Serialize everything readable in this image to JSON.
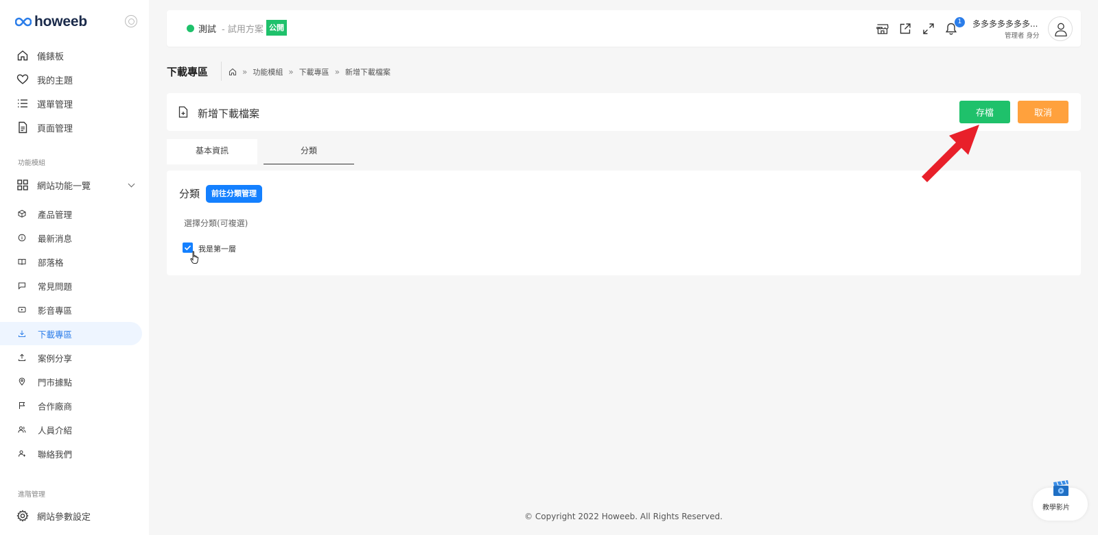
{
  "brand": {
    "name": "howeeb"
  },
  "sidebar": {
    "items": [
      {
        "label": "儀錶板",
        "icon": "home-icon"
      },
      {
        "label": "我的主題",
        "icon": "heart-icon"
      },
      {
        "label": "選單管理",
        "icon": "list-icon"
      },
      {
        "label": "頁面管理",
        "icon": "document-icon"
      }
    ],
    "section_modules": "功能模組",
    "modules_parent": {
      "label": "網站功能一覽",
      "icon": "grid-icon"
    },
    "modules": [
      {
        "label": "產品管理",
        "icon": "box-icon"
      },
      {
        "label": "最新消息",
        "icon": "info-icon"
      },
      {
        "label": "部落格",
        "icon": "book-icon"
      },
      {
        "label": "常見問題",
        "icon": "chat-icon"
      },
      {
        "label": "影音專區",
        "icon": "video-icon"
      },
      {
        "label": "下載專區",
        "icon": "download-icon"
      },
      {
        "label": "案例分享",
        "icon": "share-icon"
      },
      {
        "label": "門市據點",
        "icon": "location-icon"
      },
      {
        "label": "合作廠商",
        "icon": "flag-icon"
      },
      {
        "label": "人員介紹",
        "icon": "people-icon"
      },
      {
        "label": "聯絡我們",
        "icon": "contact-icon"
      }
    ],
    "section_advanced": "進階管理",
    "advanced": [
      {
        "label": "網站參數設定",
        "icon": "gear-icon"
      }
    ]
  },
  "topbar": {
    "site_name": "測試",
    "site_plan": "- 試用方案",
    "public_badge": "公開",
    "notification_count": "1",
    "user_name": "多多多多多多多...",
    "user_role": "管理者 身分"
  },
  "page": {
    "title": "下載專區",
    "breadcrumb": [
      "功能模組",
      "下載專區",
      "新增下載檔案"
    ],
    "form_title": "新增下載檔案",
    "save_label": "存檔",
    "cancel_label": "取消"
  },
  "tabs": [
    {
      "label": "基本資訊"
    },
    {
      "label": "分類"
    }
  ],
  "category_panel": {
    "title": "分類",
    "manage_button": "前往分類管理",
    "hint": "選擇分類(可複選)",
    "options": [
      {
        "label": "我是第一層",
        "checked": true
      }
    ]
  },
  "footer": {
    "copyright": "© Copyright 2022 Howeeb. All Rights Reserved."
  },
  "help_widget": {
    "label": "教學影片"
  },
  "colors": {
    "primary": "#1480ff",
    "success": "#1fc16b",
    "warning": "#ffa13d",
    "annotation_arrow": "#e8202a"
  }
}
